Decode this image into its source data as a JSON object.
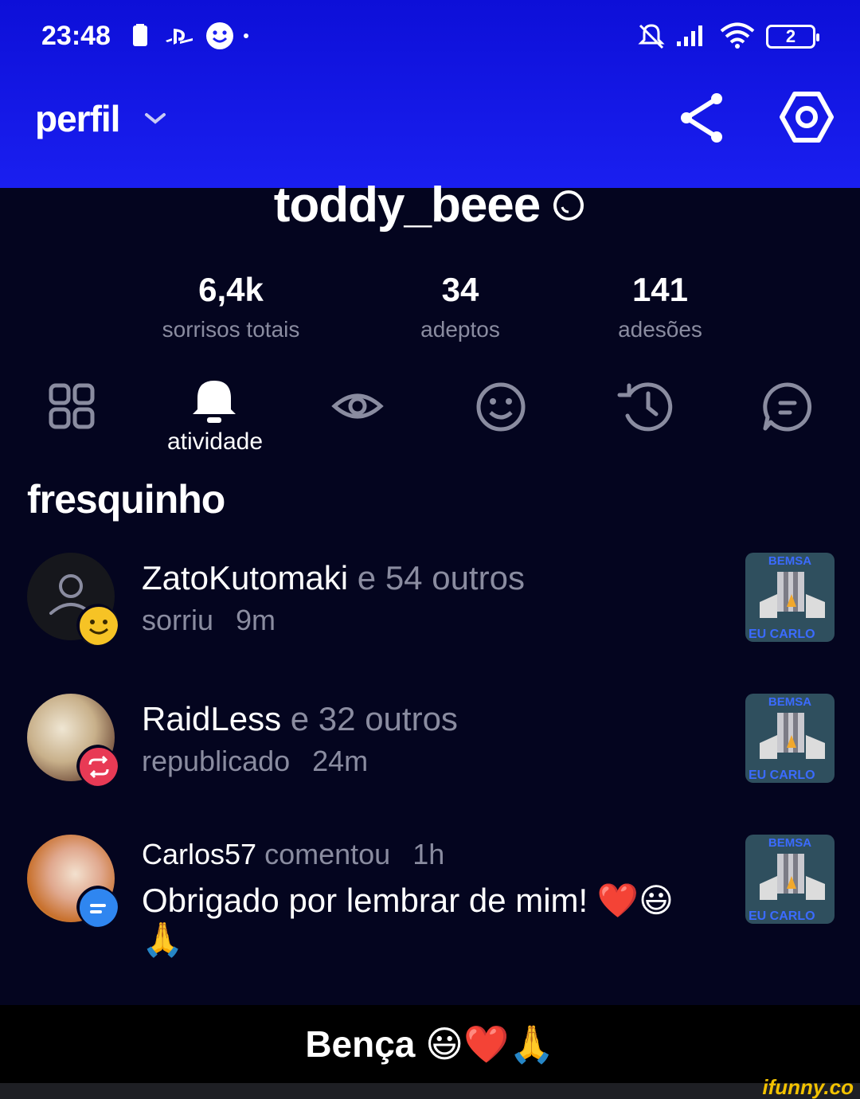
{
  "status_bar": {
    "time": "23:48",
    "battery": "2"
  },
  "header": {
    "title": "perfil"
  },
  "profile": {
    "username": "toddy_beee"
  },
  "stats": [
    {
      "value": "6,4k",
      "label": "sorrisos totais"
    },
    {
      "value": "34",
      "label": "adeptos"
    },
    {
      "value": "141",
      "label": "adesões"
    }
  ],
  "tabs": {
    "active_label": "atividade"
  },
  "section": {
    "title": "fresquinho"
  },
  "activity": [
    {
      "user": "ZatoKutomaki",
      "rest": " e 54 outros",
      "action": "sorriu",
      "time": "9m",
      "thumb_top": "BEMSA",
      "thumb_bottom": "EU CARLO"
    },
    {
      "user": "RaidLess",
      "rest": " e 32 outros",
      "action": "republicado",
      "time": "24m",
      "thumb_top": "BEMSA",
      "thumb_bottom": "EU CARLO"
    },
    {
      "user": "Carlos57",
      "action": "comentou",
      "time": "1h",
      "comment": "Obrigado por lembrar de mim! ❤️😃",
      "comment_cont": "🙏",
      "thumb_top": "BEMSA",
      "thumb_bottom": "EU CARLO"
    }
  ],
  "caption": "Bença 😃❤️🙏",
  "watermark": "ifunny.co"
}
